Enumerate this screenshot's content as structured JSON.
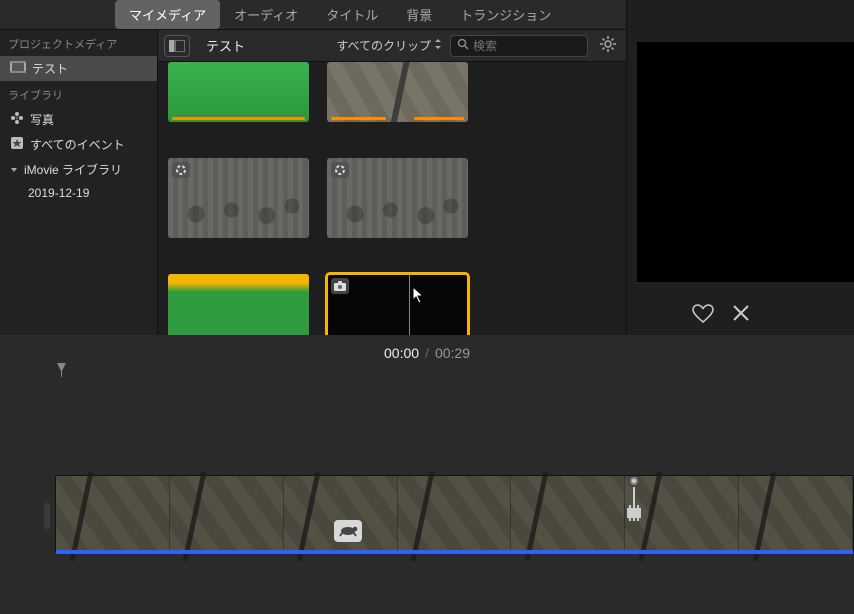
{
  "tabs": {
    "my_media": "マイメディア",
    "audio": "オーディオ",
    "titles": "タイトル",
    "backgrounds": "背景",
    "transitions": "トランジション"
  },
  "secondBar": {
    "project_name": "テスト",
    "filter_label": "すべてのクリップ",
    "search_placeholder": "検索"
  },
  "sidebar": {
    "project_media_header": "プロジェクトメディア",
    "project_item": "テスト",
    "library_header": "ライブラリ",
    "photos": "写真",
    "all_events": "すべてのイベント",
    "imovie_library": "iMovie ライブラリ",
    "event_date": "2019-12-19"
  },
  "timeline": {
    "current_time": "00:00",
    "separator": "/",
    "total_time": "00:29"
  }
}
